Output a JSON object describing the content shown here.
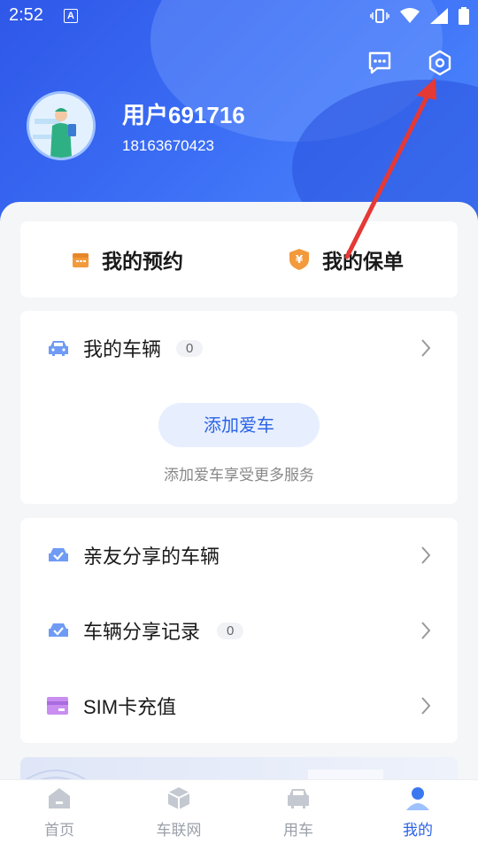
{
  "status_bar": {
    "time": "2:52",
    "notif_icon_letter": "A"
  },
  "header": {
    "message_icon": "message-icon",
    "settings_icon": "settings-hex-icon",
    "username": "用户691716",
    "phone": "18163670423"
  },
  "quick_actions": [
    {
      "label": "我的预约",
      "icon": "calendar-icon",
      "color": "#f39a3c"
    },
    {
      "label": "我的保单",
      "icon": "shield-yen-icon",
      "color": "#f39a3c"
    }
  ],
  "vehicles": {
    "title": "我的车辆",
    "count": "0",
    "add_button": "添加爱车",
    "hint": "添加爱车享受更多服务"
  },
  "menu": [
    {
      "label": "亲友分享的车辆",
      "icon": "car-check-icon"
    },
    {
      "label": "车辆分享记录",
      "icon": "car-check-icon",
      "count": "0"
    },
    {
      "label": "SIM卡充值",
      "icon": "sim-card-icon"
    }
  ],
  "tabs": [
    {
      "label": "首页",
      "icon": "home-icon"
    },
    {
      "label": "车联网",
      "icon": "cube-icon"
    },
    {
      "label": "用车",
      "icon": "car-icon"
    },
    {
      "label": "我的",
      "icon": "person-icon",
      "active": true
    }
  ],
  "colors": {
    "primary": "#2b63e8",
    "accent": "#f39a3c",
    "annotation_arrow": "#e53935"
  }
}
